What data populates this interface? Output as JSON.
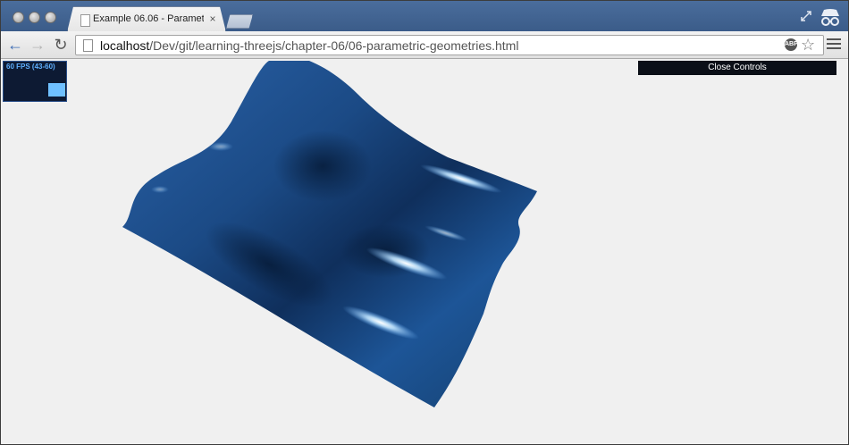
{
  "browser": {
    "tab_title": "Example 06.06 - Paramet",
    "tab_close": "×",
    "url_host": "localhost",
    "url_path": "/Dev/git/learning-threejs/chapter-06/06-parametric-geometries.html",
    "nav_icons": [
      "back-arrow-icon",
      "forward-arrow-icon",
      "reload-icon"
    ],
    "back_glyph": "←",
    "forward_glyph": "→",
    "reload_glyph": "↻",
    "star_glyph": "☆",
    "ext_label": "ABP"
  },
  "page": {
    "stats_text": "60 FPS (43-60)",
    "close_controls_label": "Close Controls",
    "surface_color": "#1d4f8e"
  }
}
